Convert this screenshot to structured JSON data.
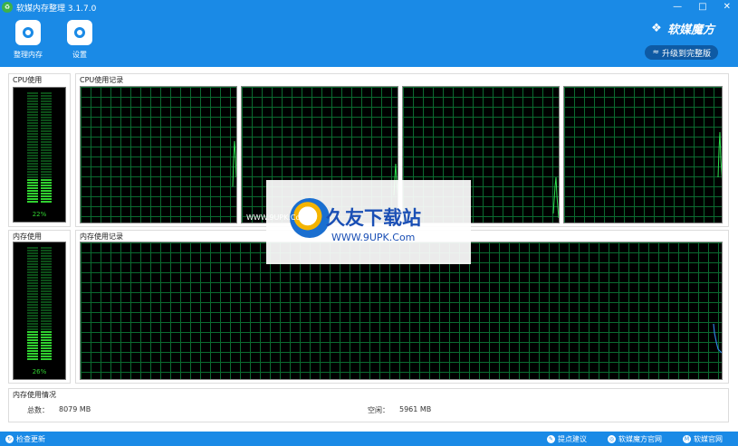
{
  "titlebar": {
    "app_title": "软媒内存整理 3.1.7.0",
    "minimize": "—",
    "maximize": "□",
    "close": "✕"
  },
  "toolbar": {
    "clean_label": "整理内存",
    "settings_label": "设置"
  },
  "brand": {
    "name": "软媒魔方",
    "upgrade_label": "升级到完整版"
  },
  "cpu_usage": {
    "title": "CPU使用",
    "percent": 22,
    "percent_text": "22%"
  },
  "cpu_history": {
    "title": "CPU使用记录"
  },
  "mem_usage": {
    "title": "内存使用",
    "percent": 26,
    "percent_text": "26%"
  },
  "mem_history": {
    "title": "内存使用记录"
  },
  "mem_info": {
    "title": "内存使用情况",
    "total_label": "总数：",
    "total_value": "8079 MB",
    "free_label": "空闲：",
    "free_value": "5961 MB"
  },
  "statusbar": {
    "check_update": "检查更新",
    "feedback": "提点建议",
    "site1": "软媒魔方官网",
    "site2": "软媒官网"
  },
  "watermark": {
    "main": "久友下载站",
    "url": "WWW.9UPK.Com",
    "url_small": "WWW.9UPK.Com"
  },
  "colors": {
    "accent": "#1a8ae6",
    "meter_green": "#30d030",
    "grid": "#0b6b30"
  }
}
